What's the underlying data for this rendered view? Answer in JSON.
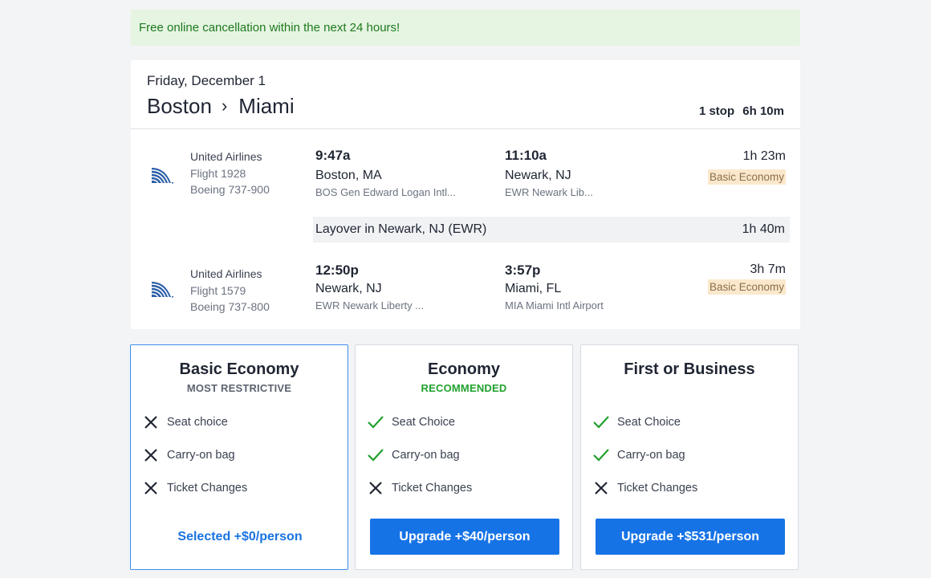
{
  "banner": {
    "text": "Free online cancellation within the next 24 hours!"
  },
  "trip": {
    "date": "Friday, December 1",
    "origin": "Boston",
    "destination": "Miami",
    "stops": "1 stop",
    "total_duration": "6h 10m"
  },
  "segments": [
    {
      "airline": "United Airlines",
      "flight": "Flight 1928",
      "aircraft": "Boeing 737-900",
      "dep_time": "9:47a",
      "dep_city": "Boston, MA",
      "dep_airport": "BOS Gen Edward Logan Intl...",
      "arr_time": "11:10a",
      "arr_city": "Newark, NJ",
      "arr_airport": "EWR Newark Lib...",
      "duration": "1h 23m",
      "fare_class": "Basic Economy"
    },
    {
      "airline": "United Airlines",
      "flight": "Flight 1579",
      "aircraft": "Boeing 737-800",
      "dep_time": "12:50p",
      "dep_city": "Newark, NJ",
      "dep_airport": "EWR Newark Liberty ...",
      "arr_time": "3:57p",
      "arr_city": "Miami, FL",
      "arr_airport": "MIA Miami Intl Airport",
      "duration": "3h 7m",
      "fare_class": "Basic Economy"
    }
  ],
  "layover": {
    "text": "Layover in Newark, NJ (EWR)",
    "duration": "1h 40m"
  },
  "fares": [
    {
      "title": "Basic Economy",
      "subtitle": "MOST RESTRICTIVE",
      "features": [
        {
          "label": "Seat choice",
          "included": false
        },
        {
          "label": "Carry-on bag",
          "included": false
        },
        {
          "label": "Ticket Changes",
          "included": false
        }
      ],
      "button": "Selected +$0/person"
    },
    {
      "title": "Economy",
      "subtitle": "RECOMMENDED",
      "features": [
        {
          "label": "Seat Choice",
          "included": true
        },
        {
          "label": "Carry-on bag",
          "included": true
        },
        {
          "label": "Ticket Changes",
          "included": false
        }
      ],
      "button": "Upgrade +$40/person"
    },
    {
      "title": "First or Business",
      "subtitle": "",
      "features": [
        {
          "label": "Seat Choice",
          "included": true
        },
        {
          "label": "Carry-on bag",
          "included": true
        },
        {
          "label": "Ticket Changes",
          "included": false
        }
      ],
      "button": "Upgrade +$531/person"
    }
  ],
  "colors": {
    "check": "#22a12f",
    "x": "#1f2532",
    "primary": "#1673e6",
    "selected_border": "#3d8fe8"
  },
  "icons": {
    "included": "check-icon",
    "excluded": "x-icon",
    "airline": "united-airlines-logo"
  }
}
